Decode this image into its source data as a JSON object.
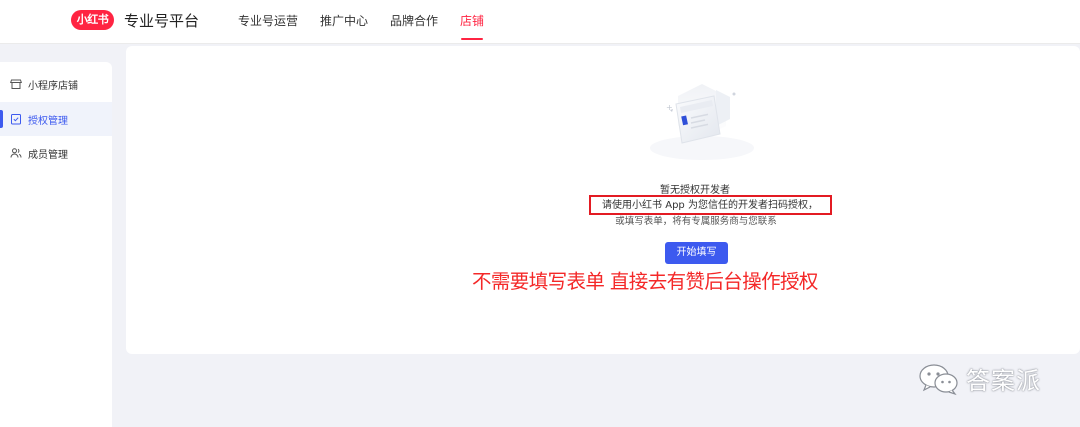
{
  "header": {
    "logo_text": "小红书",
    "platform_title": "专业号平台",
    "nav": [
      {
        "label": "专业号运营",
        "active": false
      },
      {
        "label": "推广中心",
        "active": false
      },
      {
        "label": "品牌合作",
        "active": false
      },
      {
        "label": "店铺",
        "active": true
      }
    ]
  },
  "sidebar": {
    "items": [
      {
        "label": "小程序店铺",
        "icon": "store-icon",
        "active": false
      },
      {
        "label": "授权管理",
        "icon": "authorization-icon",
        "active": true
      },
      {
        "label": "成员管理",
        "icon": "members-icon",
        "active": false
      }
    ]
  },
  "empty_state": {
    "title": "暂无授权开发者",
    "desc_line1": "请使用小红书 App 为您信任的开发者扫码授权，",
    "desc_line2": "或填写表单，将有专属服务商与您联系",
    "button_label": "开始填写"
  },
  "annotation": {
    "text": "不需要填写表单 直接去有赞后台操作授权"
  },
  "watermark": {
    "text": "答案派",
    "icon": "wechat-icon"
  },
  "colors": {
    "brand_red": "#ff2442",
    "primary_blue": "#3d5aef",
    "annotation_red": "#f42828",
    "background": "#f1f2f7"
  }
}
